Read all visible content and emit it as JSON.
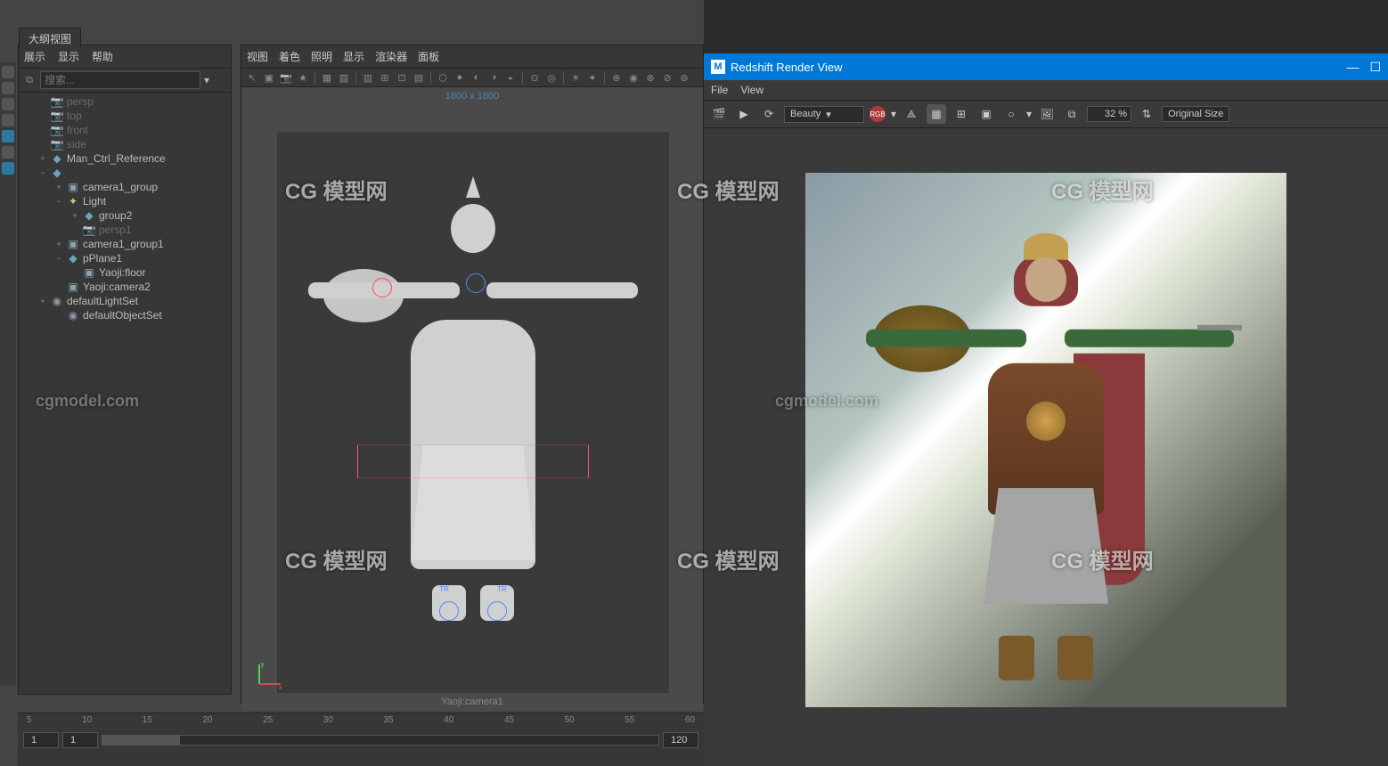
{
  "outliner": {
    "tab": "大纲视图",
    "menus": [
      "展示",
      "显示",
      "帮助"
    ],
    "search_placeholder": "搜索...",
    "tree": [
      {
        "label": "persp",
        "icon": "camera",
        "indent": 1,
        "dim": true
      },
      {
        "label": "top",
        "icon": "camera",
        "indent": 1,
        "dim": true
      },
      {
        "label": "front",
        "icon": "camera",
        "indent": 1,
        "dim": true
      },
      {
        "label": "side",
        "icon": "camera",
        "indent": 1,
        "dim": true
      },
      {
        "label": "Man_Ctrl_Reference",
        "icon": "transform",
        "indent": 1,
        "expander": "+"
      },
      {
        "label": "",
        "icon": "transform",
        "indent": 1,
        "expander": "−"
      },
      {
        "label": "camera1_group",
        "icon": "mesh",
        "indent": 2,
        "expander": "+"
      },
      {
        "label": "Light",
        "icon": "light",
        "indent": 2,
        "expander": "−"
      },
      {
        "label": "group2",
        "icon": "transform",
        "indent": 3,
        "expander": "+"
      },
      {
        "label": "persp1",
        "icon": "camera",
        "indent": 3,
        "dim": true
      },
      {
        "label": "camera1_group1",
        "icon": "mesh",
        "indent": 2,
        "expander": "+"
      },
      {
        "label": "pPlane1",
        "icon": "transform",
        "indent": 2,
        "expander": "−"
      },
      {
        "label": "Yaoji:floor",
        "icon": "mesh",
        "indent": 3
      },
      {
        "label": "Yaoji:camera2",
        "icon": "mesh",
        "indent": 2
      },
      {
        "label": "defaultLightSet",
        "icon": "set",
        "indent": 1,
        "expander": "+"
      },
      {
        "label": "defaultObjectSet",
        "icon": "set",
        "indent": 2
      }
    ]
  },
  "viewport": {
    "menus": [
      "视图",
      "着色",
      "照明",
      "显示",
      "渲染器",
      "面板"
    ],
    "resolution": "1800 x 1800",
    "camera_label": "Yaoji:camera1"
  },
  "timeline": {
    "ticks": [
      "5",
      "10",
      "15",
      "20",
      "25",
      "30",
      "35",
      "40",
      "45",
      "50",
      "55",
      "60"
    ],
    "frame_start": "1",
    "frame_current": "1",
    "frame_end": "120"
  },
  "render_view": {
    "title": "Redshift Render View",
    "app_icon_letter": "M",
    "menus": [
      "File",
      "View"
    ],
    "aov_dropdown": "Beauty",
    "rgb_badge": "RGB",
    "zoom": "32 %",
    "original_size": "Original Size"
  },
  "watermarks": {
    "logo": "CG 模型网",
    "url": "cgmodel.com"
  }
}
